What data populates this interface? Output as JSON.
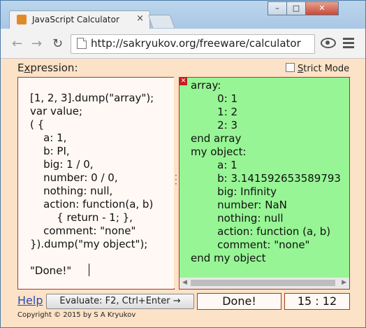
{
  "browser": {
    "tab_title": "JavaScript Calculator",
    "tab_close": "×",
    "window_controls": {
      "minimize": "–",
      "maximize": "□",
      "close": "✕"
    },
    "url": "http://sakryukov.org/freeware/calculator"
  },
  "page": {
    "expression_label_prefix": "E",
    "expression_label_accel": "x",
    "expression_label_rest": "pression:",
    "strict_mode_accel": "S",
    "strict_mode_rest": "trict Mode",
    "strict_mode_checked": false,
    "editor_text": "[1, 2, 3].dump(\"array\");\nvar value;\n( {\n    a: 1,\n    b: PI,\n    big: 1 / 0,\n    number: 0 / 0,\n    nothing: null,\n    action: function(a, b)\n        { return - 1; },\n    comment: \"none\"\n}).dump(\"my object\");\n\n\"Done!\"",
    "output_text": "array:\n        0: 1\n        1: 2\n        2: 3\nend array\nmy object:\n        a: 1\n        b: 3.141592653589793\n        big: Infinity\n        number: NaN\n        nothing: null\n        action: function (a, b)\n        comment: \"none\"\nend my object",
    "help_link": "Help",
    "evaluate_button": "Evaluate: F2, Ctrl+Enter →",
    "status": "Done!",
    "timer": "15 : 12",
    "copyright": "Copyright © 2015 by S A Kryukov"
  }
}
